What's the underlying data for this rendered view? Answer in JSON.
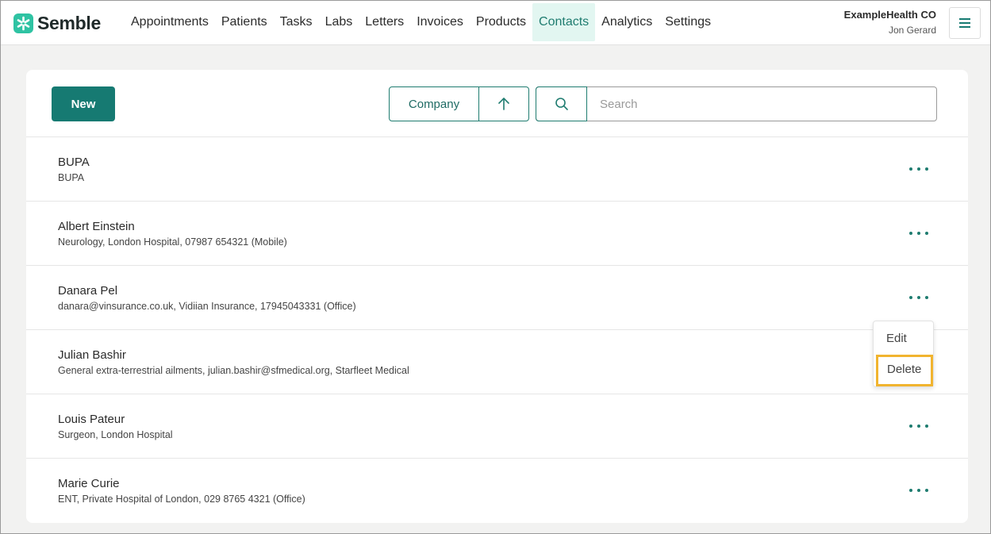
{
  "brand": {
    "name": "Semble",
    "accent": "#167a72",
    "logo_color": "#2fc3a3"
  },
  "nav": {
    "items": [
      {
        "label": "Appointments"
      },
      {
        "label": "Patients"
      },
      {
        "label": "Tasks"
      },
      {
        "label": "Labs"
      },
      {
        "label": "Letters"
      },
      {
        "label": "Invoices"
      },
      {
        "label": "Products"
      },
      {
        "label": "Contacts",
        "active": true
      },
      {
        "label": "Analytics"
      },
      {
        "label": "Settings"
      }
    ]
  },
  "account": {
    "org": "ExampleHealth CO",
    "user": "Jon Gerard",
    "menu_icon": "hamburger-icon"
  },
  "toolbar": {
    "new_label": "New",
    "sort_field": "Company",
    "sort_direction_icon": "arrow-up-icon",
    "search_icon": "search-icon",
    "search_placeholder": "Search"
  },
  "contacts": [
    {
      "name": "BUPA",
      "detail": "BUPA"
    },
    {
      "name": "Albert Einstein",
      "detail": "Neurology, London Hospital, 07987 654321 (Mobile)"
    },
    {
      "name": "Danara Pel",
      "detail": "danara@vinsurance.co.uk, Vidiian Insurance, 17945043331 (Office)"
    },
    {
      "name": "Julian Bashir",
      "detail": "General extra-terrestrial ailments, julian.bashir@sfmedical.org, Starfleet Medical"
    },
    {
      "name": "Louis Pateur",
      "detail": "Surgeon, London Hospital"
    },
    {
      "name": "Marie Curie",
      "detail": "ENT, Private Hospital of London, 029 8765 4321 (Office)"
    }
  ],
  "row_menu": {
    "items": [
      {
        "label": "Edit"
      },
      {
        "label": "Delete",
        "highlighted": true
      }
    ],
    "highlight_color": "#f1b42f"
  }
}
